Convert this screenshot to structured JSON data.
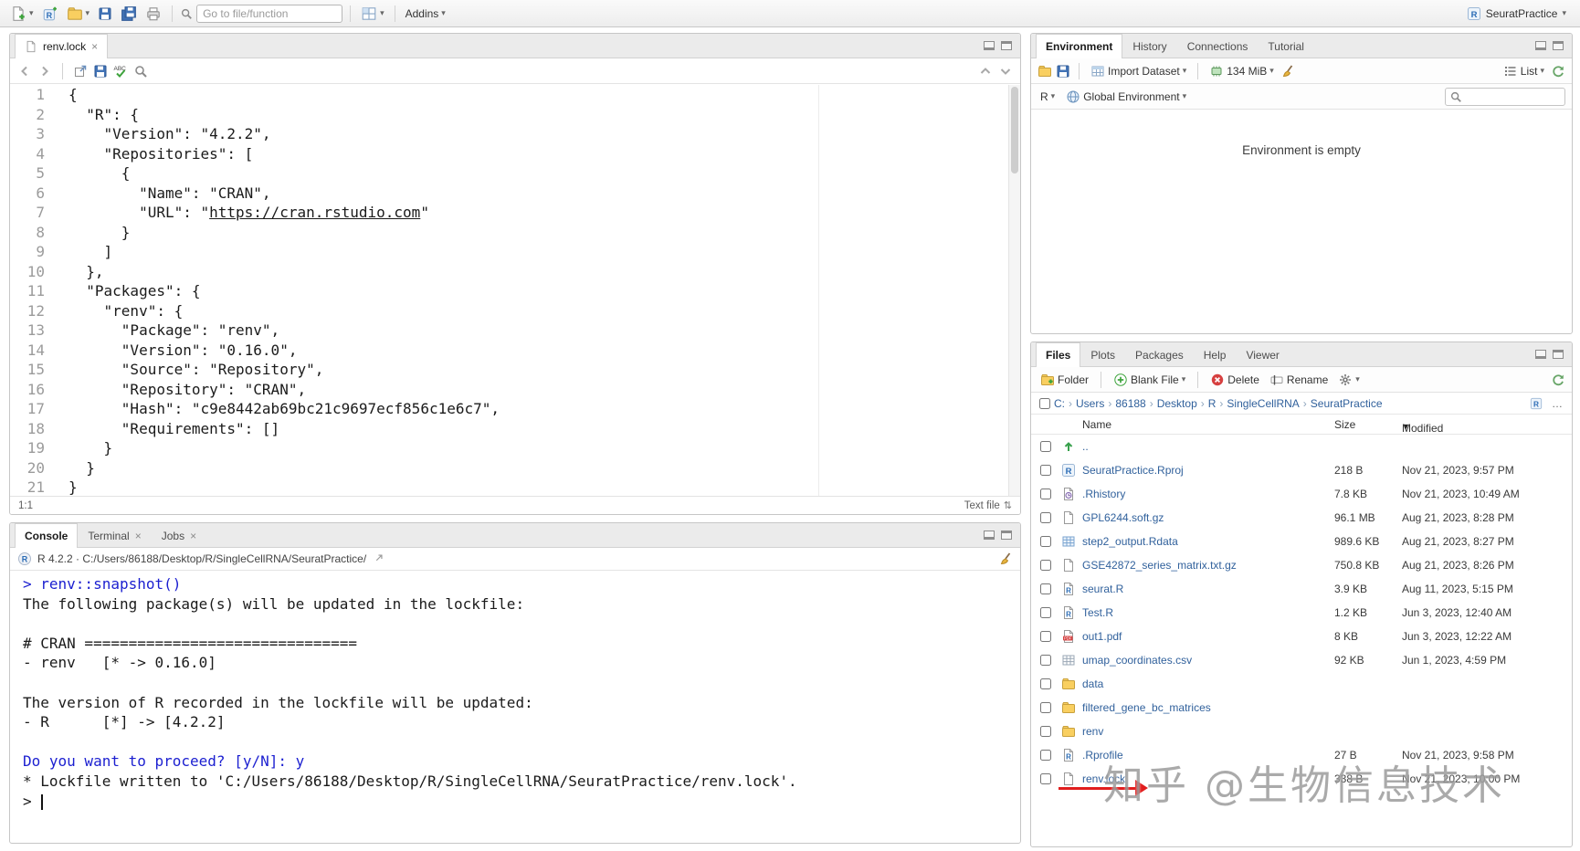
{
  "toolbar": {
    "goto_placeholder": "Go to file/function",
    "addins_label": "Addins",
    "project_label": "SeuratPractice"
  },
  "icons": {
    "caret": "▾",
    "close": "×",
    "chevron": "›",
    "sort_desc": "▼",
    "ellipsis": "…",
    "updown": "⇅"
  },
  "colors": {
    "console_input_blue": "#1b1fd0",
    "file_link_blue": "#31619c",
    "annotation_red": "#e11d1d",
    "folder_yellow": "#f9cf60",
    "r_logo_blue": "#2b6cb5"
  },
  "source_pane": {
    "tab_label": "renv.lock",
    "status_position": "1:1",
    "file_type_label": "Text file",
    "link_url": "https://cran.rstudio.com",
    "lines": [
      "{",
      "  \"R\": {",
      "    \"Version\": \"4.2.2\",",
      "    \"Repositories\": [",
      "      {",
      "        \"Name\": \"CRAN\",",
      "        \"URL\": \"https://cran.rstudio.com\"",
      "      }",
      "    ]",
      "  },",
      "  \"Packages\": {",
      "    \"renv\": {",
      "      \"Package\": \"renv\",",
      "      \"Version\": \"0.16.0\",",
      "      \"Source\": \"Repository\",",
      "      \"Repository\": \"CRAN\",",
      "      \"Hash\": \"c9e8442ab69bc21c9697ecf856c1e6c7\",",
      "      \"Requirements\": []",
      "    }",
      "  }",
      "}"
    ]
  },
  "console_pane": {
    "tabs": [
      "Console",
      "Terminal",
      "Jobs"
    ],
    "header_text": "R 4.2.2 · C:/Users/86188/Desktop/R/SingleCellRNA/SeuratPractice/",
    "lines": [
      {
        "type": "input",
        "text": "> renv::snapshot()"
      },
      {
        "type": "output",
        "text": "The following package(s) will be updated in the lockfile:"
      },
      {
        "type": "output",
        "text": ""
      },
      {
        "type": "output",
        "text": "# CRAN ==============================="
      },
      {
        "type": "output",
        "text": "- renv   [* -> 0.16.0]"
      },
      {
        "type": "output",
        "text": ""
      },
      {
        "type": "output",
        "text": "The version of R recorded in the lockfile will be updated:"
      },
      {
        "type": "output",
        "text": "- R      [*] -> [4.2.2]"
      },
      {
        "type": "output",
        "text": ""
      },
      {
        "type": "input",
        "text": "Do you want to proceed? [y/N]: y"
      },
      {
        "type": "output",
        "text": "* Lockfile written to 'C:/Users/86188/Desktop/R/SingleCellRNA/SeuratPractice/renv.lock'."
      },
      {
        "type": "prompt",
        "text": "> "
      }
    ]
  },
  "env_pane": {
    "tabs": [
      "Environment",
      "History",
      "Connections",
      "Tutorial"
    ],
    "import_label": "Import Dataset",
    "memory_label": "134 MiB",
    "list_label": "List",
    "r_label": "R",
    "scope_label": "Global Environment",
    "empty_message": "Environment is empty"
  },
  "files_pane": {
    "tabs": [
      "Files",
      "Plots",
      "Packages",
      "Help",
      "Viewer"
    ],
    "actions": {
      "new_folder": "Folder",
      "new_blank_file": "Blank File",
      "delete": "Delete",
      "rename": "Rename"
    },
    "breadcrumb": [
      "C:",
      "Users",
      "86188",
      "Desktop",
      "R",
      "SingleCellRNA",
      "SeuratPractice"
    ],
    "columns": {
      "name": "Name",
      "size": "Size",
      "modified": "Modified"
    },
    "rows": [
      {
        "icon": "up",
        "name": "..",
        "size": "",
        "modified": ""
      },
      {
        "icon": "rproj",
        "name": "SeuratPractice.Rproj",
        "size": "218 B",
        "modified": "Nov 21, 2023, 9:57 PM"
      },
      {
        "icon": "rhistory",
        "name": ".Rhistory",
        "size": "7.8 KB",
        "modified": "Nov 21, 2023, 10:49 AM"
      },
      {
        "icon": "file",
        "name": "GPL6244.soft.gz",
        "size": "96.1 MB",
        "modified": "Aug 21, 2023, 8:28 PM"
      },
      {
        "icon": "rdata",
        "name": "step2_output.Rdata",
        "size": "989.6 KB",
        "modified": "Aug 21, 2023, 8:27 PM"
      },
      {
        "icon": "file",
        "name": "GSE42872_series_matrix.txt.gz",
        "size": "750.8 KB",
        "modified": "Aug 21, 2023, 8:26 PM"
      },
      {
        "icon": "rfile",
        "name": "seurat.R",
        "size": "3.9 KB",
        "modified": "Aug 11, 2023, 5:15 PM"
      },
      {
        "icon": "rfile",
        "name": "Test.R",
        "size": "1.2 KB",
        "modified": "Jun 3, 2023, 12:40 AM"
      },
      {
        "icon": "pdf",
        "name": "out1.pdf",
        "size": "8 KB",
        "modified": "Jun 3, 2023, 12:22 AM"
      },
      {
        "icon": "csv",
        "name": "umap_coordinates.csv",
        "size": "92 KB",
        "modified": "Jun 1, 2023, 4:59 PM"
      },
      {
        "icon": "folder",
        "name": "data",
        "size": "",
        "modified": ""
      },
      {
        "icon": "folder",
        "name": "filtered_gene_bc_matrices",
        "size": "",
        "modified": ""
      },
      {
        "icon": "folder",
        "name": "renv",
        "size": "",
        "modified": ""
      },
      {
        "icon": "rprofile",
        "name": ".Rprofile",
        "size": "27 B",
        "modified": "Nov 21, 2023, 9:58 PM"
      },
      {
        "icon": "file",
        "name": "renv.lock",
        "size": "338 B",
        "modified": "Nov 21, 2023, 10:00 PM"
      }
    ]
  },
  "watermark": "知乎 @生物信息技术"
}
